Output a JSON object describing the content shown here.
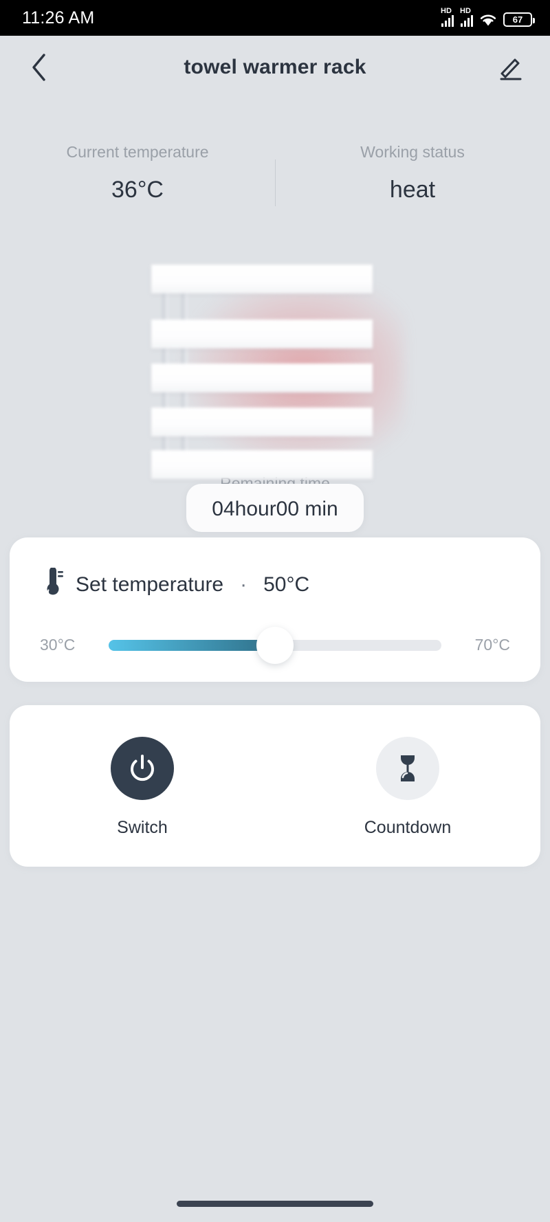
{
  "status_bar": {
    "time": "11:26 AM",
    "sim1_label": "HD",
    "sim2_label": "HD",
    "wifi_icon": "wifi-icon",
    "battery_level": "67"
  },
  "header": {
    "back_icon": "chevron-left-icon",
    "title": "towel warmer rack",
    "edit_icon": "pencil-edit-icon"
  },
  "stats": {
    "current_temperature": {
      "label": "Current temperature",
      "value": "36°C"
    },
    "working_status": {
      "label": "Working status",
      "value": "heat"
    },
    "remaining_time": {
      "label": "Remaining time",
      "value": "04hour00 min"
    }
  },
  "toast": {
    "text": "04hour00 min"
  },
  "device": {
    "name": "towel-warmer-rack-illustration",
    "bar_count": 5
  },
  "temperature_card": {
    "icon": "thermometer-icon",
    "title": "Set temperature",
    "separator": "·",
    "value": "50°C",
    "slider": {
      "min_label": "30°C",
      "max_label": "70°C",
      "min": 30,
      "max": 70,
      "current": 50,
      "fill_percent": 50,
      "fill_start_color": "#55c3e8",
      "fill_end_color": "#2f6f88",
      "track_color": "#e6e8ec"
    }
  },
  "actions": [
    {
      "label": "Switch",
      "icon": "power-icon",
      "state": "on",
      "circle_color": "#333f4e"
    },
    {
      "label": "Countdown",
      "icon": "hourglass-icon",
      "state": "off",
      "circle_color": "#eceef1"
    }
  ],
  "theme": {
    "background": "#dfe2e6",
    "card_background": "#ffffff",
    "text_primary": "#2c3440",
    "text_muted": "#9aa0a8",
    "accent": "#333f4e"
  }
}
